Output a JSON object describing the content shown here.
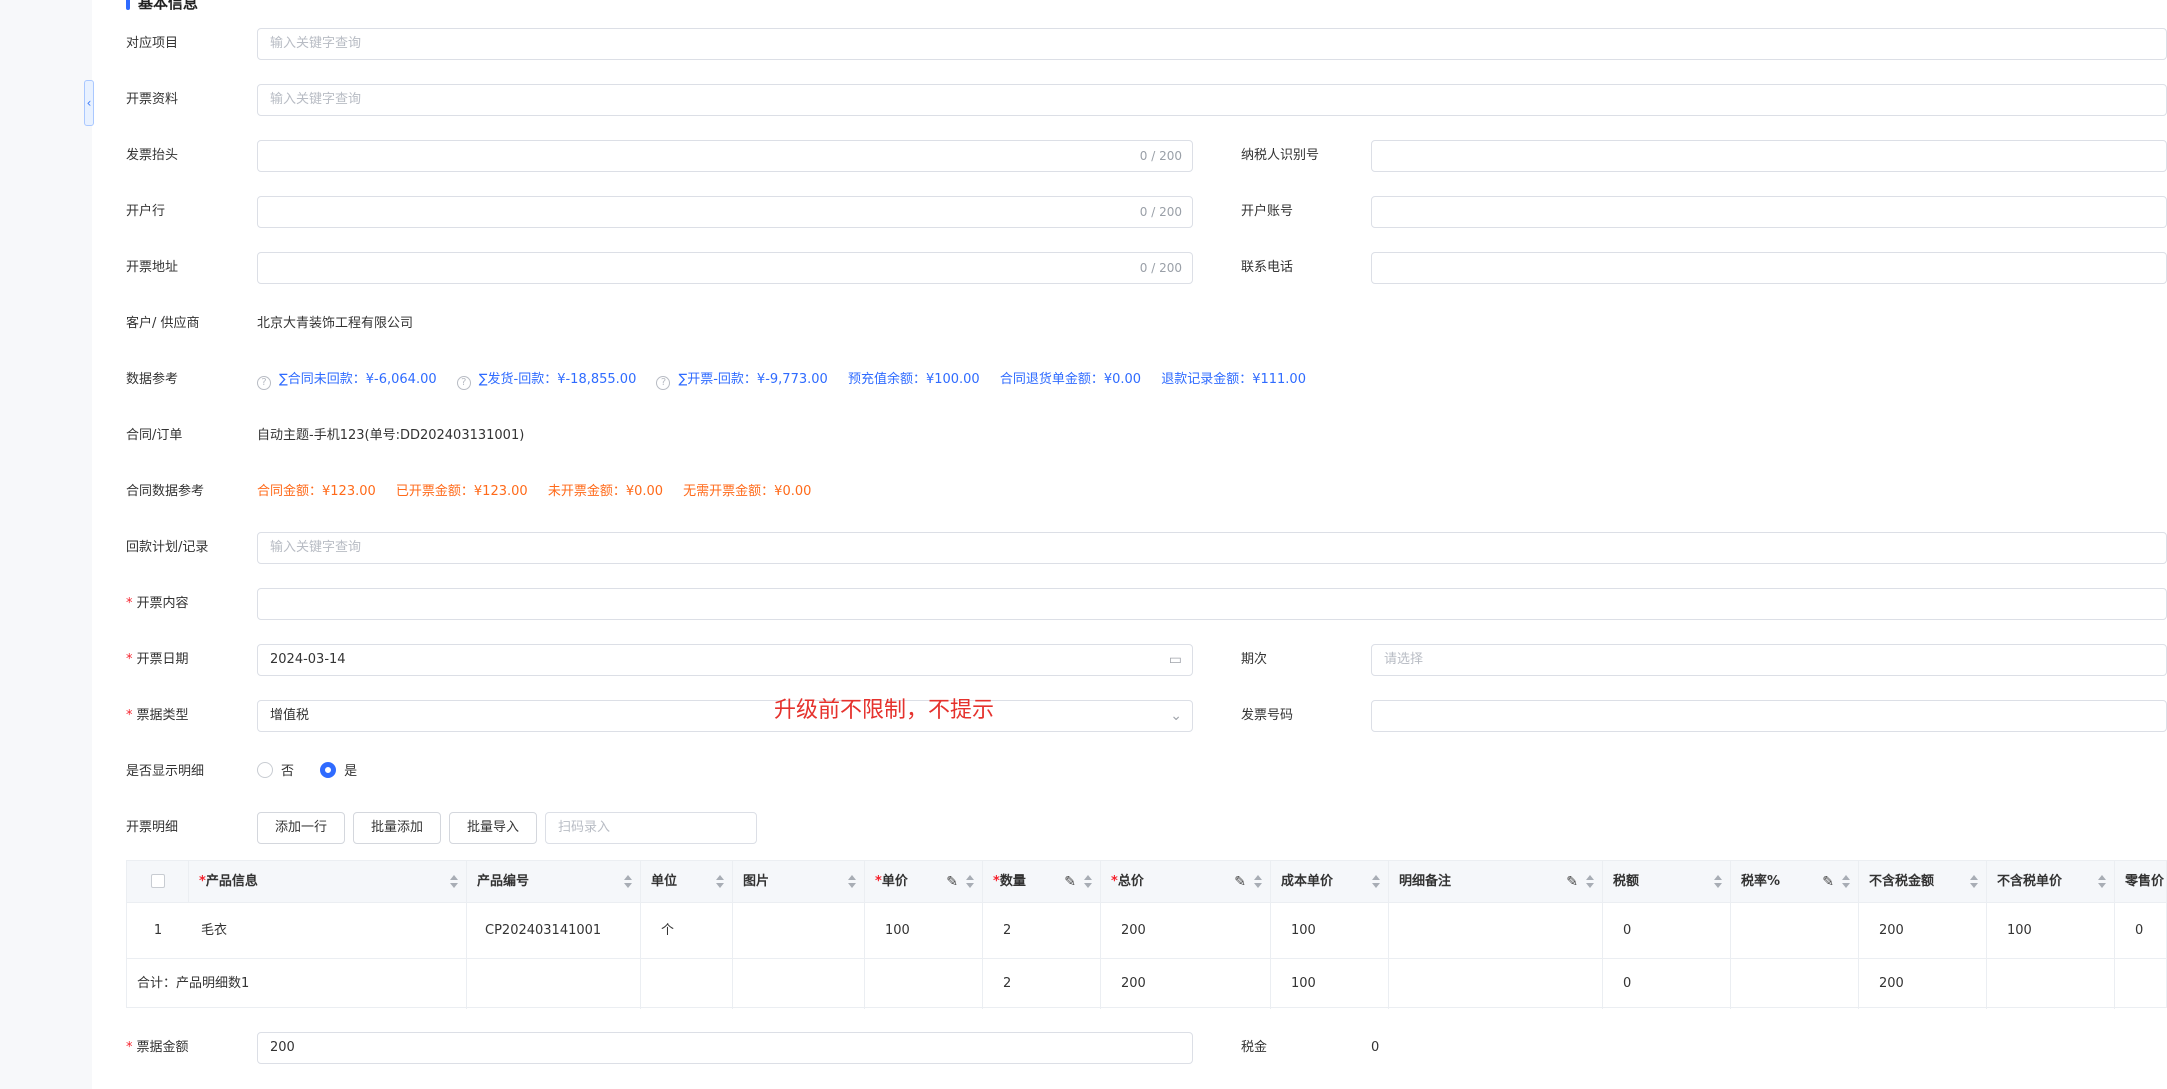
{
  "section": {
    "title": "基本信息"
  },
  "fields": {
    "project": {
      "label": "对应项目",
      "placeholder": "输入关键字查询"
    },
    "invoice_profile": {
      "label": "开票资料",
      "placeholder": "输入关键字查询"
    },
    "invoice_title": {
      "label": "发票抬头",
      "counter": "0 / 200"
    },
    "taxpayer_id": {
      "label": "纳税人识别号"
    },
    "bank": {
      "label": "开户行",
      "counter": "0 / 200"
    },
    "account": {
      "label": "开户账号"
    },
    "invoice_address": {
      "label": "开票地址",
      "counter": "0 / 200"
    },
    "phone": {
      "label": "联系电话"
    },
    "customer": {
      "label": "客户/ 供应商",
      "value": "北京大青装饰工程有限公司"
    },
    "data_ref": {
      "label": "数据参考",
      "items": [
        "∑合同未回款：¥-6,064.00",
        "∑发货-回款：¥-18,855.00",
        "∑开票-回款：¥-9,773.00",
        "预充值余额：¥100.00",
        "合同退货单金额：¥0.00",
        "退款记录金额：¥111.00"
      ]
    },
    "contract": {
      "label": "合同/订单",
      "value": "自动主题-手机123(单号:DD202403131001)"
    },
    "contract_ref": {
      "label": "合同数据参考",
      "items": [
        "合同金额：¥123.00",
        "已开票金额：¥123.00",
        "未开票金额：¥0.00",
        "无需开票金额：¥0.00"
      ]
    },
    "payment_plan": {
      "label": "回款计划/记录",
      "placeholder": "输入关键字查询"
    },
    "content": {
      "label": "开票内容"
    },
    "date": {
      "label": "开票日期",
      "value": "2024-03-14"
    },
    "period": {
      "label": "期次",
      "placeholder": "请选择"
    },
    "ticket_type": {
      "label": "票据类型",
      "value": "增值税"
    },
    "invoice_no": {
      "label": "发票号码"
    },
    "show_detail": {
      "label": "是否显示明细",
      "option_no": "否",
      "option_yes": "是",
      "selected": "是"
    },
    "detail": {
      "label": "开票明细",
      "btn_add_row": "添加一行",
      "btn_batch_add": "批量添加",
      "btn_batch_import": "批量导入",
      "scan_placeholder": "扫码录入"
    },
    "amount": {
      "label": "票据金额",
      "value": "200"
    },
    "tax": {
      "label": "税金",
      "value": "0"
    }
  },
  "annotation": "升级前不限制，不提示",
  "table": {
    "headers": [
      "产品信息",
      "产品编号",
      "单位",
      "图片",
      "单价",
      "数量",
      "总价",
      "成本单价",
      "明细备注",
      "税额",
      "税率%",
      "不含税金额",
      "不含税单价",
      "零售价"
    ],
    "row": [
      "1",
      "毛衣",
      "CP202403141001",
      "个",
      "",
      "100",
      "2",
      "200",
      "100",
      "",
      "0",
      "",
      "200",
      "100",
      "0"
    ],
    "total": {
      "label": "合计：产品明细数1",
      "qty": "2",
      "total": "200",
      "cost": "100",
      "tax": "0",
      "notax": "200"
    }
  }
}
